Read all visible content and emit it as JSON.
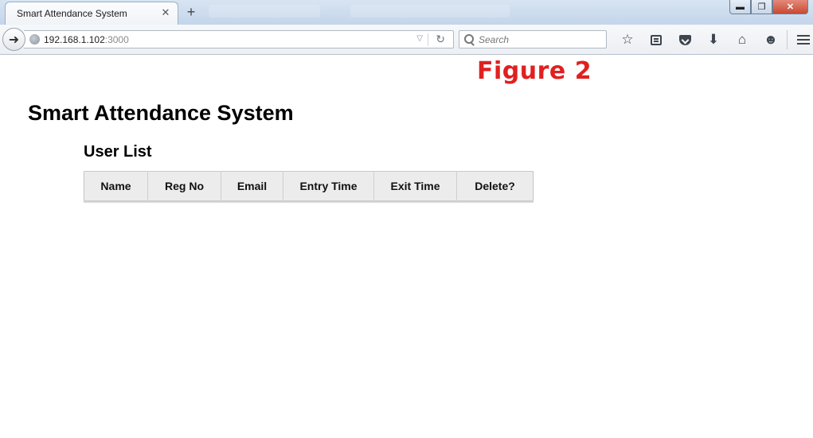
{
  "browser": {
    "tab": {
      "title": "Smart Attendance System",
      "close_glyph": "✕"
    },
    "new_tab_glyph": "+",
    "window_controls": {
      "minimize": "▬",
      "maximize": "❐",
      "close": "✕"
    },
    "address": {
      "host": "192.168.1.102",
      "port": ":3000"
    },
    "search": {
      "placeholder": "Search"
    }
  },
  "page": {
    "figure_label": "Figure 2",
    "title": "Smart Attendance System",
    "section_title": "User List",
    "table": {
      "headers": [
        "Name",
        "Reg No",
        "Email",
        "Entry Time",
        "Exit Time",
        "Delete?"
      ],
      "rows": []
    }
  },
  "icons": [
    "back-arrow-icon",
    "globe-icon",
    "dropdown-icon",
    "reload-icon",
    "search-icon",
    "bookmark-star-icon",
    "reading-list-icon",
    "pocket-icon",
    "download-icon",
    "home-icon",
    "smiley-icon",
    "menu-icon"
  ],
  "colors": {
    "figure_label": "#e02020",
    "table_header_bg": "#ececec",
    "titlebar": "#c4d5ea"
  }
}
